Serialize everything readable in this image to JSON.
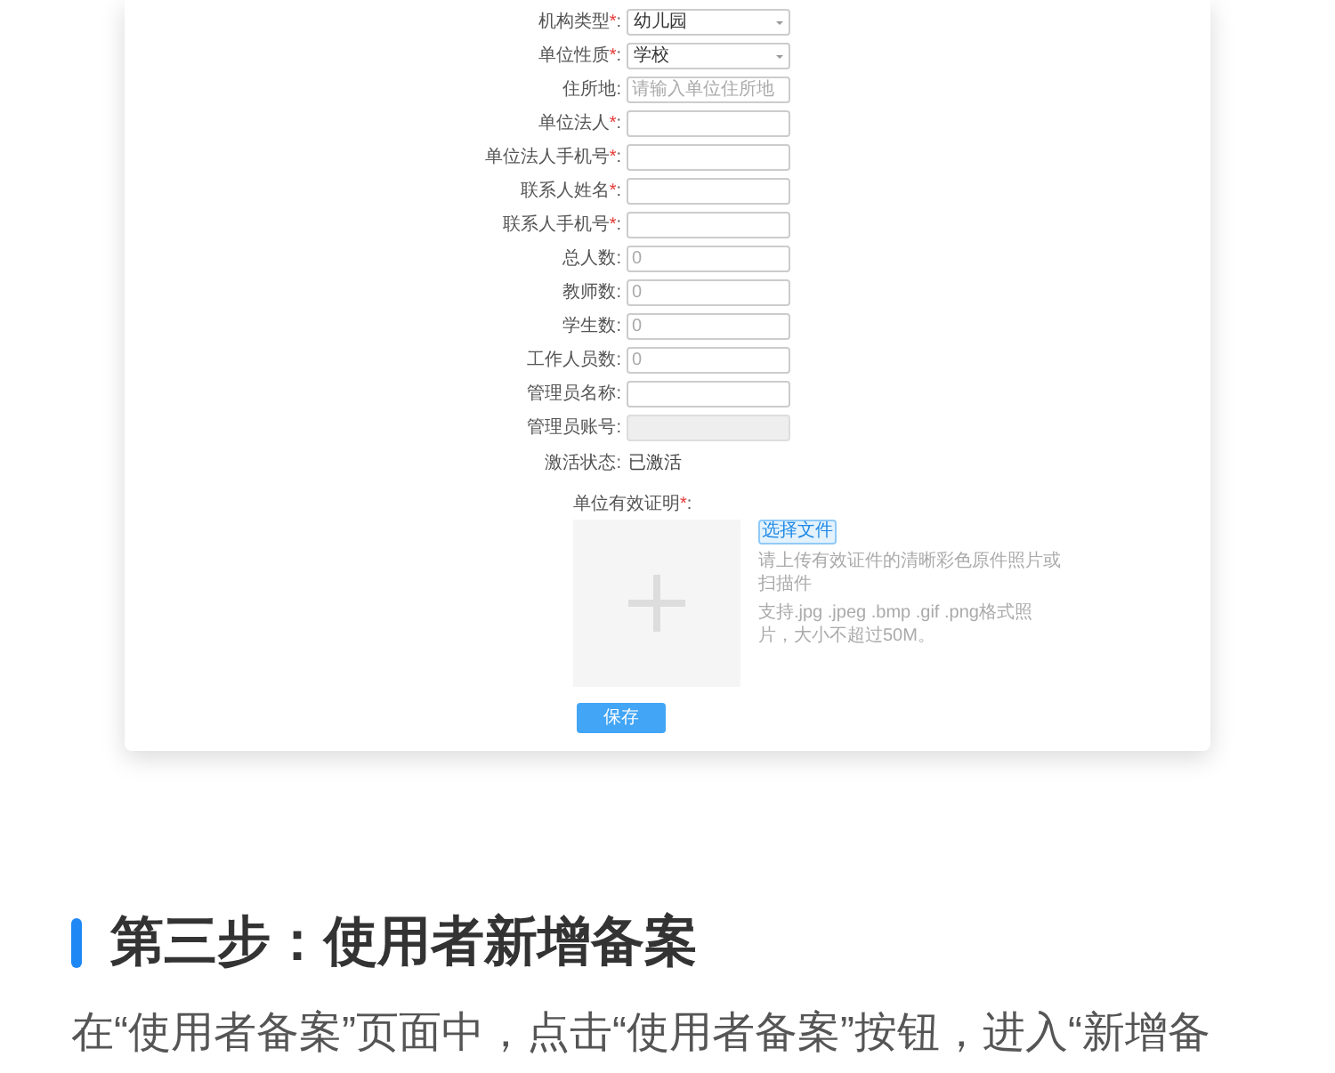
{
  "form": {
    "fields": [
      {
        "label": "机构类型",
        "asterisk": "*",
        "colon": ":",
        "kind": "select",
        "value": "幼儿园"
      },
      {
        "label": "单位性质",
        "asterisk": "*",
        "colon": ":",
        "kind": "select",
        "value": "学校"
      },
      {
        "label": "住所地",
        "colon": ":",
        "kind": "input",
        "placeholder": "请输入单位住所地"
      },
      {
        "label": "单位法人",
        "asterisk": "*",
        "colon": ":",
        "kind": "input"
      },
      {
        "label": "单位法人手机号",
        "asterisk": "*",
        "colon": ":",
        "kind": "input"
      },
      {
        "label": "联系人姓名",
        "asterisk": "*",
        "colon": ":",
        "kind": "input"
      },
      {
        "label": "联系人手机号",
        "asterisk": "*",
        "colon": ":",
        "kind": "input"
      },
      {
        "label": "总人数",
        "colon": ":",
        "kind": "input",
        "placeholder": "0"
      },
      {
        "label": "教师数",
        "colon": ":",
        "kind": "input",
        "placeholder": "0"
      },
      {
        "label": "学生数",
        "colon": ":",
        "kind": "input",
        "placeholder": "0"
      },
      {
        "label": "工作人员数",
        "colon": ":",
        "kind": "input",
        "placeholder": "0"
      },
      {
        "label": "管理员名称",
        "colon": ":",
        "kind": "input"
      },
      {
        "label": "管理员账号",
        "colon": ":",
        "kind": "disabled"
      },
      {
        "label": "激活状态",
        "colon": ":",
        "kind": "text",
        "value": "已激活"
      }
    ],
    "upload": {
      "label": "单位有效证明",
      "asterisk": "*",
      "colon": ":",
      "button": "选择文件",
      "hint": [
        "请上传有效证件的清晰彩色原件照片或扫描件",
        "支持.jpg .jpeg .bmp .gif .png格式照片，大小不超过50M。"
      ]
    },
    "save_button": "保存"
  },
  "article": {
    "heading": "第三步：使用者新增备案",
    "paragraph": "在“使用者备案”页面中，点击“使用者备案”按钮，进入“新增备"
  }
}
